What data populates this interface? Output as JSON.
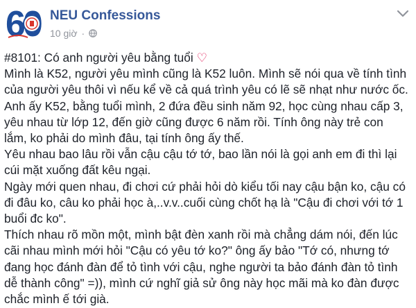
{
  "page": {
    "name": "NEU Confessions",
    "time": "10 giờ",
    "logo_text": "60"
  },
  "post": {
    "title": "#8101: Có anh người yêu bằng tuổi",
    "title_emoji": "♡",
    "paragraphs": [
      "Mình là K52, người yêu mình cũng là K52 luôn. Mình sẽ nói qua về tính tình\ncủa người yêu thôi vì nếu kể về cả quá trình yêu có lẽ sẽ nhạt như nước ốc.\nAnh ấy K52, bằng tuổi mình, 2 đứa đều sinh năm 92, học cùng nhau cấp 3,\nyêu nhau từ lớp 12, đến giờ cũng được 6 năm rồi. Tính ông này trẻ con\nlắm, ko phải do mình đâu, tại tính ông ấy thế.",
      "Yêu nhau bao lâu rồi vẫn cậu cậu tớ tớ, bao lần nói là gọi anh em đi thì lại\ncúi mặt xuống đất kêu ngại.",
      "Ngày mới quen nhau, đi chơi cứ phải hỏi dò kiểu tối nay cậu bận ko, cậu có\nđi đâu ko, câu ko phải học à,..v.v..cuối cùng chốt hạ là \"Cậu đi chơi với tớ 1\nbuổi đc ko\".",
      "Thích nhau rõ mồn một, mình bật đèn xanh rồi mà chẳng dám nói, đến lúc\ncãi nhau mình mới hỏi \"Cậu có yêu tớ ko?\" ông ấy bảo \"Tớ có, nhưng tớ\nđang học đánh đàn để tỏ tình với cậu, nghe người ta bảo đánh đàn tỏ tình\ndễ thành công\" =)), mình cứ nghĩ giả sử ông này học mãi mà ko đàn được\nchắc mình ế tới già."
    ]
  },
  "colors": {
    "link": "#365899",
    "meta": "#90949c",
    "text": "#1d2129",
    "logo_blue": "#1f4e9c",
    "heart": "#e0245e"
  },
  "icons": {
    "privacy": "globe-icon",
    "menu": "chevron-down-icon"
  }
}
